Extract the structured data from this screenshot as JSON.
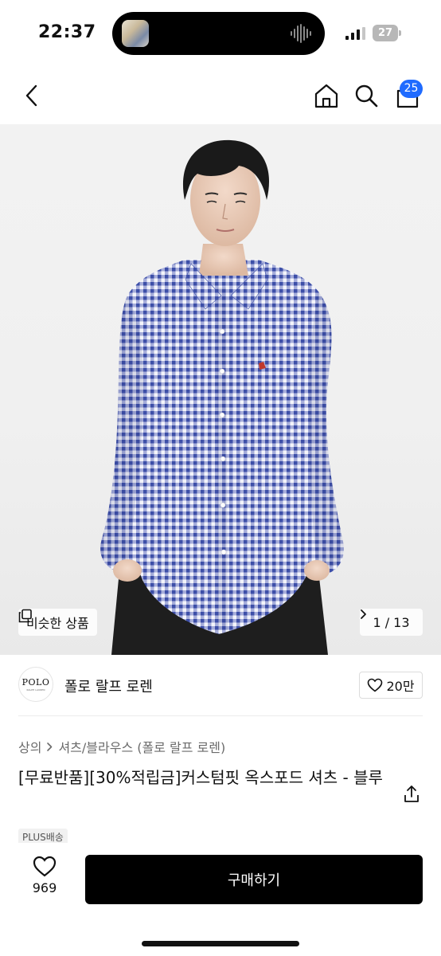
{
  "status_bar": {
    "time": "22:37",
    "battery": "27",
    "icons": [
      "island-thumbnail",
      "audio-wave-icon",
      "signal-icon",
      "battery-icon"
    ]
  },
  "nav": {
    "icons": [
      "chevron-left-icon",
      "home-icon",
      "search-icon",
      "cart-icon"
    ],
    "cart_count": "25"
  },
  "hero": {
    "similar_label": "비슷한 상품",
    "similar_icon": "copy-icon",
    "page_indicator": "1 / 13"
  },
  "brand": {
    "logo_text": "POLO",
    "logo_subtext": "RALPH LAUREN",
    "name": "폴로 랄프 로렌",
    "likes": "20만"
  },
  "breadcrumb": {
    "category": "상의",
    "subcategory": "셔츠/블라우스 (폴로 랄프 로렌)"
  },
  "product": {
    "title": "[무료반품][30%적립금]커스텀핏 옥스포드 셔츠 - 블루",
    "delivery_badge": "PLUS배송"
  },
  "bottom": {
    "wish_count": "969",
    "buy_label": "구매하기"
  },
  "colors": {
    "badge_blue": "#1f6bff",
    "buy_button": "#000000",
    "shirt_blue": "#3d4fa8"
  }
}
